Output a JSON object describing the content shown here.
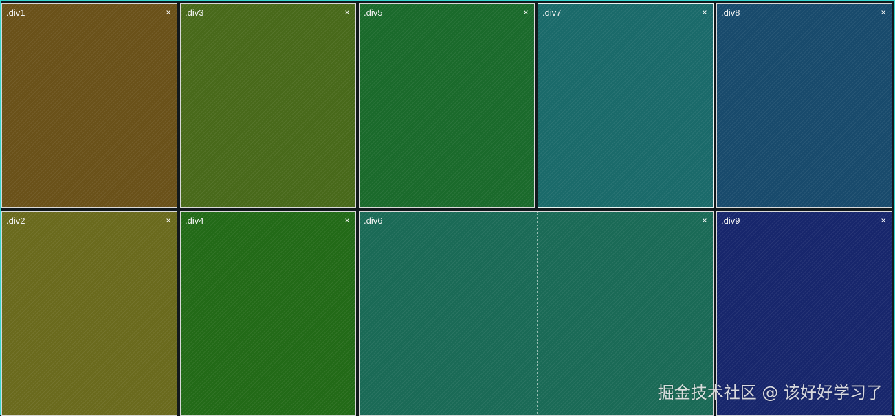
{
  "panels": {
    "div1": {
      "label": ".div1",
      "close": "×",
      "color": "#6a5119"
    },
    "div2": {
      "label": ".div2",
      "close": "×",
      "color": "#6a6a1d"
    },
    "div3": {
      "label": ".div3",
      "close": "×",
      "color": "#48691a"
    },
    "div4": {
      "label": ".div4",
      "close": "×",
      "color": "#226a17"
    },
    "div5": {
      "label": ".div5",
      "close": "×",
      "color": "#1a6a2b"
    },
    "div6": {
      "label": ".div6",
      "close": "×",
      "color": "#1a6a56"
    },
    "div7": {
      "label": ".div7",
      "close": "×",
      "color": "#1a6a6a"
    },
    "div8": {
      "label": ".div8",
      "close": "×",
      "color": "#184a6c"
    },
    "div9": {
      "label": ".div9",
      "close": "×",
      "color": "#17266c"
    }
  },
  "watermark": "掘金技术社区 @ 该好好学习了",
  "colors": {
    "frame_accent": "#38d6cf",
    "panel_border": "#d9d9d9"
  }
}
